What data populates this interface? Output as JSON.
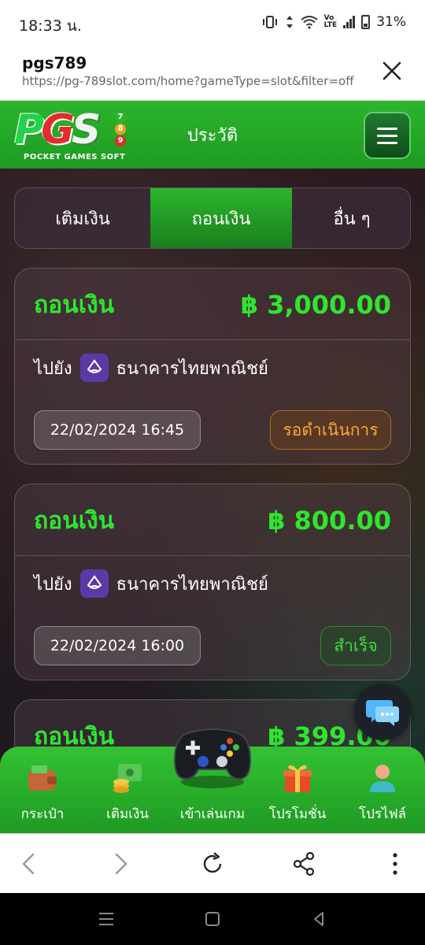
{
  "status": {
    "time": "18:33 น.",
    "battery": "31%"
  },
  "browser": {
    "site": "pgs789",
    "url": "https://pg-789slot.com/home?gameType=slot&filter=off"
  },
  "header": {
    "logo_text": "PGS",
    "logo_sub": "POCKET GAMES SOFT",
    "logo_nums": [
      "7",
      "8",
      "9"
    ],
    "title": "ประวัติ"
  },
  "tabs": [
    {
      "label": "เติมเงิน",
      "active": false
    },
    {
      "label": "ถอนเงิน",
      "active": true
    },
    {
      "label": "อื่น ๆ",
      "active": false
    }
  ],
  "transactions": [
    {
      "title": "ถอนเงิน",
      "amount": "฿ 3,000.00",
      "to_label": "ไปยัง",
      "bank": "ธนาคารไทยพาณิชย์",
      "datetime": "22/02/2024 16:45",
      "status": "รอดำเนินการ"
    },
    {
      "title": "ถอนเงิน",
      "amount": "฿ 800.00",
      "to_label": "ไปยัง",
      "bank": "ธนาคารไทยพาณิชย์",
      "datetime": "22/02/2024 16:00",
      "status": "สำเร็จ"
    },
    {
      "title": "ถอนเงิน",
      "amount": "฿ 399.00"
    }
  ],
  "bottom_nav": [
    {
      "label": "กระเป๋า",
      "icon": "wallet-icon"
    },
    {
      "label": "เติมเงิน",
      "icon": "money-coins-icon"
    },
    {
      "label": "เข้าเล่นเกม",
      "icon": "gamepad-icon"
    },
    {
      "label": "โปรโมชั่น",
      "icon": "gift-icon"
    },
    {
      "label": "โปรไฟล์",
      "icon": "profile-icon"
    }
  ],
  "colors": {
    "brand_green": "#2db52d",
    "amount_green": "#2ee62e",
    "pending_orange": "#ffa53a",
    "success_green": "#3dde3d"
  }
}
